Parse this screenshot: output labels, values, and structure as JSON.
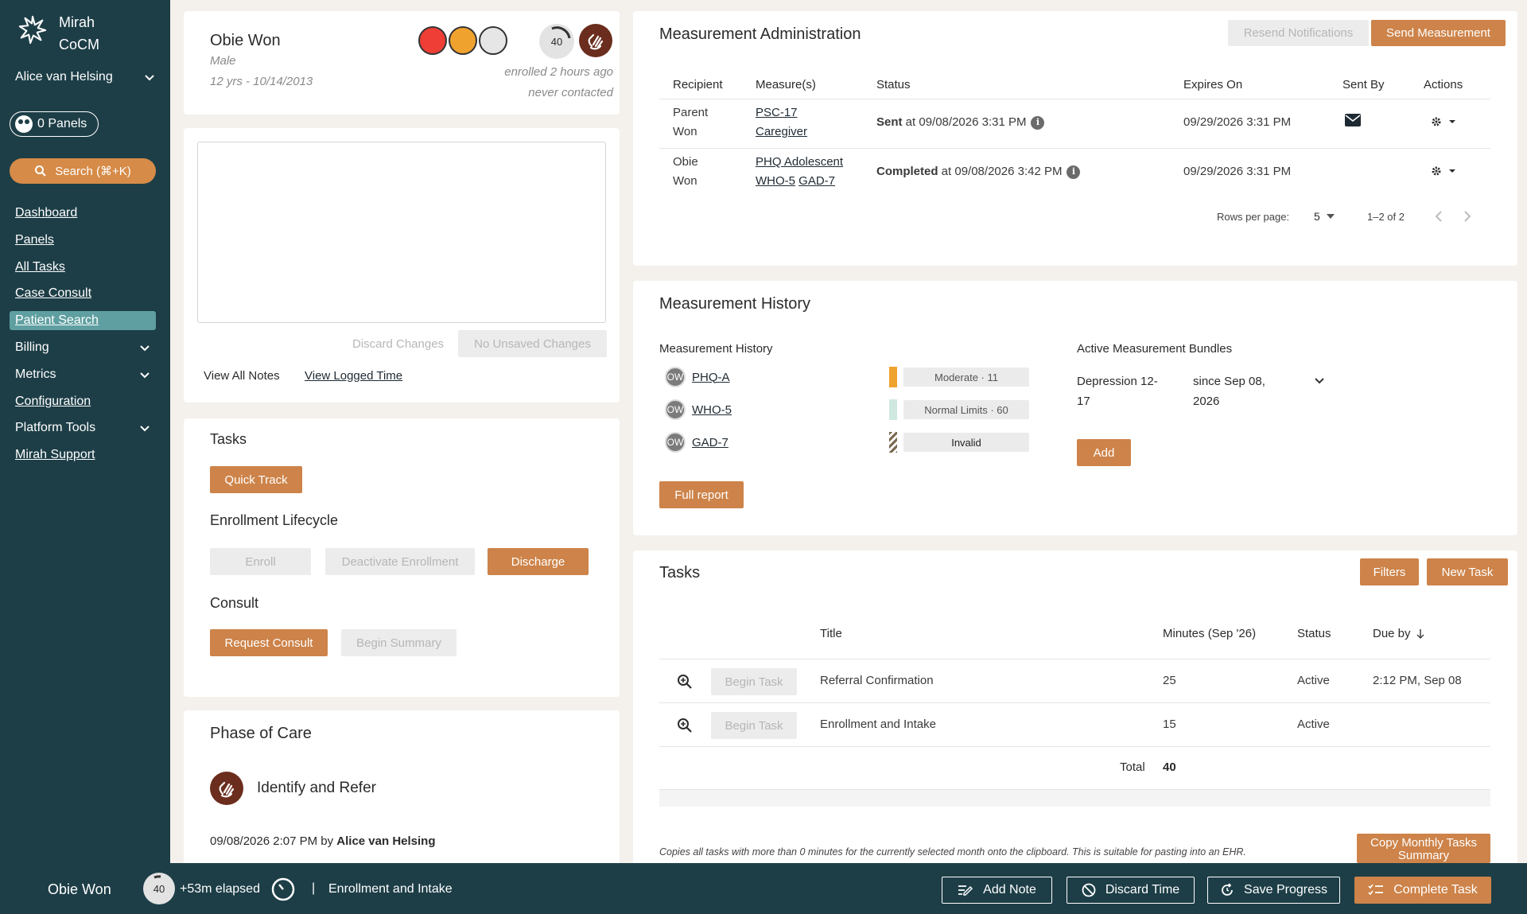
{
  "sidebar": {
    "brand": {
      "line1": "Mirah",
      "line2": "CoCM"
    },
    "user": "Alice van Helsing",
    "panels": "0 Panels",
    "search": "Search  (⌘+K)",
    "nav": [
      {
        "label": "Dashboard",
        "dropdown": false
      },
      {
        "label": "Panels",
        "dropdown": false
      },
      {
        "label": "All Tasks",
        "dropdown": false
      },
      {
        "label": "Case Consult",
        "dropdown": false
      },
      {
        "label": "Patient Search",
        "dropdown": false,
        "active": true
      },
      {
        "label": "Billing",
        "dropdown": true
      },
      {
        "label": "Metrics",
        "dropdown": true
      },
      {
        "label": "Configuration",
        "dropdown": false
      },
      {
        "label": "Platform Tools",
        "dropdown": true
      },
      {
        "label": "Mirah Support",
        "dropdown": false
      }
    ]
  },
  "patient": {
    "name": "Obie Won",
    "sex": "Male",
    "age_dob": "12 yrs - 10/14/2013",
    "score": "40",
    "enrolled": "enrolled 2 hours ago",
    "contacted": "never contacted",
    "dot_colors": [
      "#ee3e36",
      "#f0a22e",
      "#e6e6e6"
    ]
  },
  "notes": {
    "discard": "Discard Changes",
    "no_changes": "No Unsaved Changes",
    "view_all": "View All Notes",
    "view_logged": "View Logged Time"
  },
  "tasks_card": {
    "title": "Tasks",
    "quick_track": "Quick Track",
    "enrollment_title": "Enrollment Lifecycle",
    "enroll": "Enroll",
    "deactivate": "Deactivate Enrollment",
    "discharge": "Discharge",
    "consult_title": "Consult",
    "request_consult": "Request Consult",
    "begin_summary": "Begin Summary"
  },
  "phase": {
    "title": "Phase of Care",
    "label": "Identify and Refer",
    "date": "09/08/2026 2:07 PM by ",
    "by": "Alice van Helsing"
  },
  "admin": {
    "title": "Measurement Administration",
    "resend": "Resend Notifications",
    "send": "Send Measurement",
    "headers": [
      "Recipient",
      "Measure(s)",
      "Status",
      "Expires On",
      "Sent By",
      "Actions"
    ],
    "rows": [
      {
        "r1": "Parent",
        "r2": "Won",
        "m1": "PSC-17",
        "m2": "Caregiver",
        "m3": "",
        "status_b": "Sent",
        "status_t": " at 09/08/2026 3:31 PM",
        "expires": "09/29/2026 3:31 PM"
      },
      {
        "r1": "Obie",
        "r2": "Won",
        "m1": "PHQ Adolescent",
        "m2": "WHO-5",
        "m3": "GAD-7",
        "status_b": "Completed",
        "status_t": " at 09/08/2026 3:42 PM",
        "expires": "09/29/2026 3:31 PM"
      }
    ],
    "rows_per_page": "Rows per page:",
    "rows_val": "5",
    "range": "1–2 of 2"
  },
  "history": {
    "title": "Measurement History",
    "subtitle": "Measurement History",
    "bundles_title": "Active Measurement Bundles",
    "items": [
      {
        "initials": "OW",
        "name": "PHQ-A",
        "label": "Moderate · 11",
        "color": "#f0a22e"
      },
      {
        "initials": "OW",
        "name": "WHO-5",
        "label": "Normal Limits · 60",
        "color": "#cfe8e0"
      },
      {
        "initials": "OW",
        "name": "GAD-7",
        "label": "Invalid",
        "color": "#7a6a50"
      }
    ],
    "full_report": "Full report",
    "bundle_name": "Depression 12-17",
    "bundle_since": "since Sep 08, 2026",
    "add": "Add"
  },
  "tasks": {
    "title": "Tasks",
    "filters": "Filters",
    "new_task": "New Task",
    "headers": {
      "title": "Title",
      "minutes": "Minutes (Sep '26)",
      "status": "Status",
      "due": "Due by"
    },
    "rows": [
      {
        "begin": "Begin Task",
        "title": "Referral Confirmation",
        "minutes": "25",
        "status": "Active",
        "due": "2:12 PM, Sep 08"
      },
      {
        "begin": "Begin Task",
        "title": "Enrollment and Intake",
        "minutes": "15",
        "status": "Active",
        "due": ""
      }
    ],
    "total_label": "Total",
    "total": "40",
    "copy_note": "Copies all tasks with more than 0 minutes for the currently selected month onto the clipboard. This is suitable for pasting into an EHR.",
    "copy_btn": "Copy Monthly Tasks Summary"
  },
  "bottom": {
    "patient": "Obie Won",
    "score": "40",
    "elapsed": "+53m elapsed",
    "sep": "|",
    "task": "Enrollment and Intake",
    "add_note": "Add Note",
    "discard_time": "Discard Time",
    "save_progress": "Save Progress",
    "complete_task": "Complete Task"
  }
}
